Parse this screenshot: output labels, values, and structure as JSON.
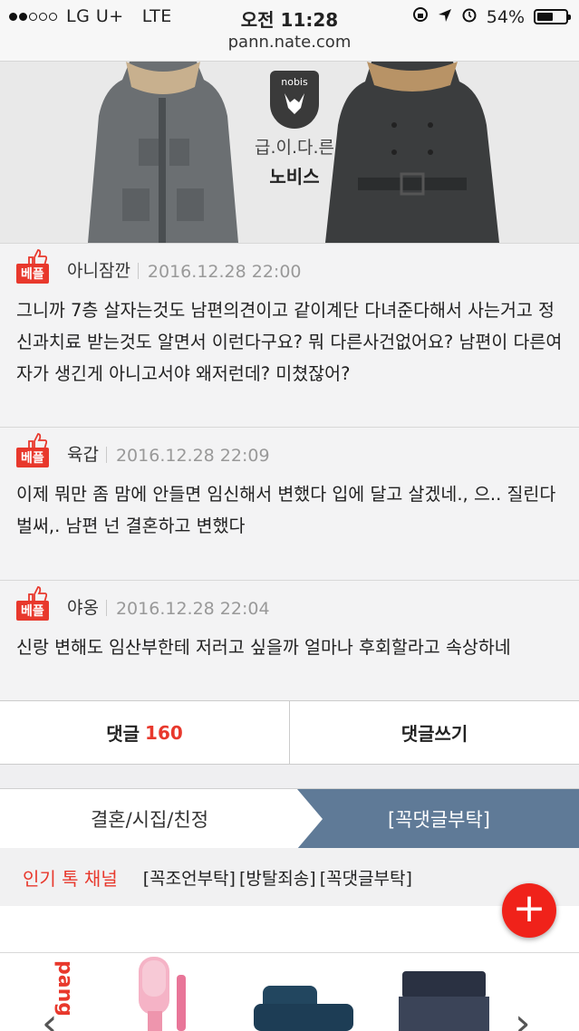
{
  "status_bar": {
    "carrier": "LG U+",
    "network": "LTE",
    "time": "오전 11:28",
    "battery": "54%",
    "battery_level": 0.54
  },
  "browser": {
    "url": "pann.nate.com"
  },
  "ad_banner": {
    "brand_logo": "nobis",
    "tagline": "급.이.다.른",
    "brand_name": "노비스"
  },
  "comments": [
    {
      "badge": "베플",
      "author": "아니잠깐",
      "date": "2016.12.28 22:00",
      "text": "그니까 7층 살자는것도 남편의견이고 같이계단 다녀준다해서 사는거고 정신과치료 받는것도 알면서 이런다구요? 뭐 다른사건없어요? 남편이 다른여자가 생긴게 아니고서야 왜저런데? 미쳤잖어?"
    },
    {
      "badge": "베플",
      "author": "육갑",
      "date": "2016.12.28 22:09",
      "text": "이제 뭐만 좀 맘에 안들면 임신해서 변했다 입에 달고 살겠네., 으.. 질린다 벌써,. 남편 넌 결혼하고 변했다"
    },
    {
      "badge": "베플",
      "author": "야옹",
      "date": "2016.12.28 22:04",
      "text": "신랑 변해도 임산부한테 저러고 싶을까 얼마나 후회할라고 속상하네"
    }
  ],
  "comment_bar": {
    "comments_label": "댓글",
    "comments_count": "160",
    "write_label": "댓글쓰기"
  },
  "channel_tabs": {
    "left": "결혼/시집/친정",
    "right": "[꼭댓글부탁]"
  },
  "popular": {
    "title": "인기 톡 채널",
    "links": [
      "[꼭조언부탁]",
      "[방탈죄송]",
      "[꼭댓글부탁]"
    ]
  },
  "fab": {
    "label": "+"
  },
  "ad_strip": {
    "brand": "pang",
    "prev": "‹",
    "next": "›"
  },
  "colors": {
    "accent": "#e8382c",
    "tab_active": "#5f7a97",
    "fab": "#f0221a"
  }
}
